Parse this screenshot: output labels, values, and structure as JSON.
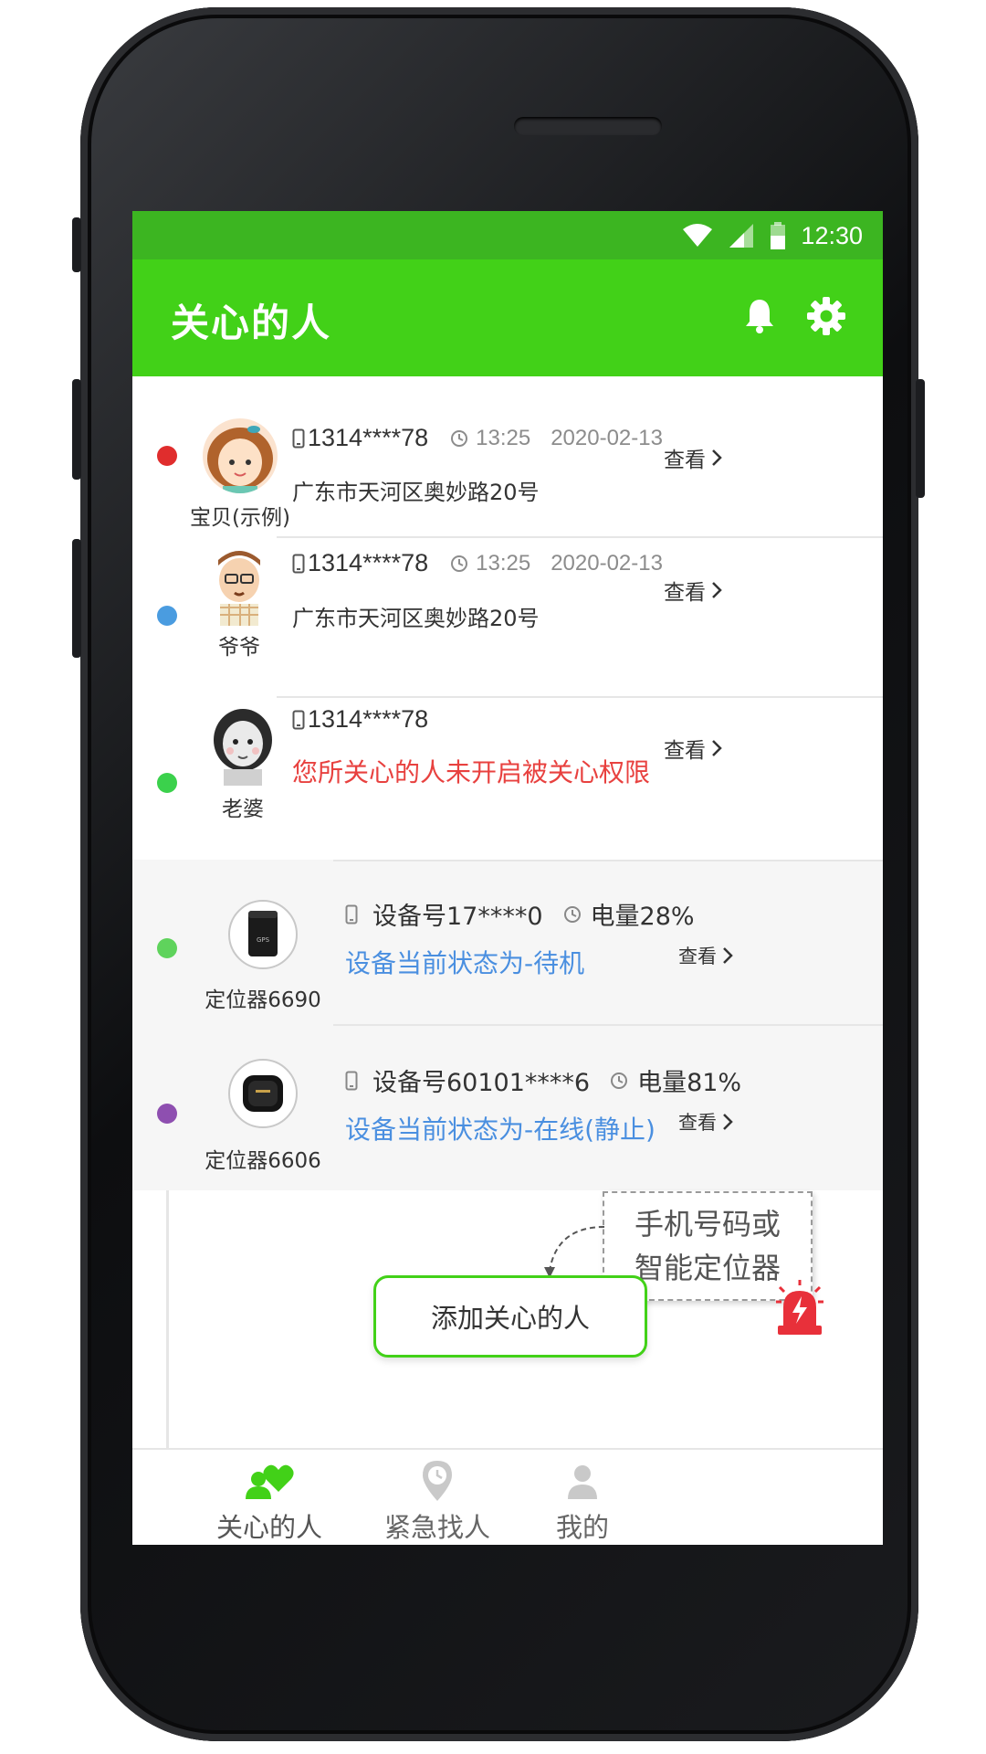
{
  "status_bar": {
    "time": "12:30"
  },
  "app_bar": {
    "title": "关心的人"
  },
  "people": [
    {
      "name": "宝贝(示例)",
      "phone": "1314****78",
      "time": "13:25",
      "date": "2020-02-13",
      "address": "广东市天河区奥妙路20号",
      "dot_color": "#e02d2d",
      "view": "查看"
    },
    {
      "name": "爷爷",
      "phone": "1314****78",
      "time": "13:25",
      "date": "2020-02-13",
      "address": "广东市天河区奥妙路20号",
      "dot_color": "#4a9ce0",
      "view": "查看"
    },
    {
      "name": "老婆",
      "phone": "1314****78",
      "warning": "您所关心的人未开启被关心权限",
      "dot_color": "#3bd14c",
      "view": "查看"
    }
  ],
  "devices": [
    {
      "name": "定位器6690",
      "device_id": "设备号17****0",
      "battery": "电量28%",
      "status": "设备当前状态为-待机",
      "dot_color": "#5fd35c",
      "view": "查看"
    },
    {
      "name": "定位器6606",
      "device_id": "设备号60101****6",
      "battery": "电量81%",
      "status": "设备当前状态为-在线(静止)",
      "dot_color": "#8e4fb0",
      "view": "查看"
    }
  ],
  "tooltip": {
    "line1": "手机号码或",
    "line2": "智能定位器"
  },
  "add_button": {
    "label": "添加关心的人"
  },
  "bottom_nav": [
    {
      "label": "关心的人",
      "icon": "people-heart-icon",
      "active": true
    },
    {
      "label": "紧急找人",
      "icon": "location-clock-icon",
      "active": false
    },
    {
      "label": "我的",
      "icon": "user-icon",
      "active": false
    }
  ],
  "colors": {
    "status_bar": "#3cb521",
    "app_bar": "#42d118",
    "warning": "#e8413f",
    "device_status": "#4a8fe0",
    "alarm": "#e8303a"
  }
}
